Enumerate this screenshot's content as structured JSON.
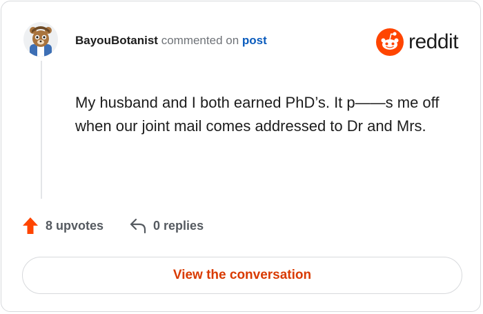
{
  "comment": {
    "author": "BayouBotanist",
    "action": "commented on",
    "target_link": "post",
    "text": "My husband and I both earned PhD’s. It p——s me off when our joint mail comes addressed to Dr and Mrs.",
    "upvotes": "8 upvotes",
    "replies": "0 replies"
  },
  "brand": {
    "name": "reddit",
    "color": "#ff4500"
  },
  "actions": {
    "view_conversation": "View the conversation"
  },
  "colors": {
    "accent": "#d93a00",
    "link": "#0b5cbd",
    "upvote": "#ff4500"
  },
  "icons": {
    "upvote": "arrow-up-icon",
    "reply": "reply-arrow-icon",
    "logo": "reddit-snoo-icon"
  }
}
